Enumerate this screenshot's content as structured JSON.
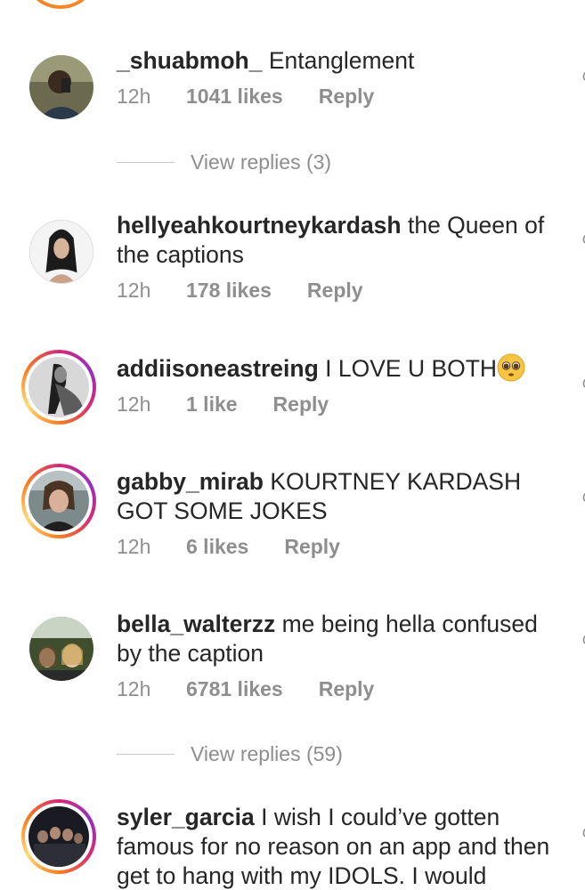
{
  "comments": [
    {
      "username": "_shuabmoh_",
      "text": "Entanglement",
      "time": "12h",
      "likes": "1041 likes",
      "reply_label": "Reply",
      "story_ring": false
    },
    {
      "username": "hellyeahkourtneykardash",
      "text": "the Queen of the captions",
      "time": "12h",
      "likes": "178 likes",
      "reply_label": "Reply",
      "story_ring": false
    },
    {
      "username": "addiisoneastreing",
      "text": "I LOVE U BOTH",
      "emoji": "pleading-face-emoji",
      "time": "12h",
      "likes": "1 like",
      "reply_label": "Reply",
      "story_ring": true
    },
    {
      "username": "gabby_mirab",
      "text": "KOURTNEY KARDASH GOT SOME JOKES",
      "time": "12h",
      "likes": "6 likes",
      "reply_label": "Reply",
      "story_ring": true
    },
    {
      "username": "bella_walterzz",
      "text": "me being hella confused by the caption",
      "time": "12h",
      "likes": "6781 likes",
      "reply_label": "Reply",
      "story_ring": false
    },
    {
      "username": "syler_garcia",
      "text": "I wish I could’ve gotten famous for no reason on an app and then get to hang with my IDOLS. I would",
      "story_ring": true
    }
  ],
  "view_replies": [
    {
      "label": "View replies (3)"
    },
    {
      "label": "View replies (59)"
    }
  ],
  "icons": {
    "like": "heart-outline-icon",
    "emoji": "pleading-face-emoji"
  },
  "colors": {
    "text": "#262626",
    "secondary": "#8e8e8e",
    "story_ring_start": "#d62976",
    "story_ring_end": "#feda75"
  }
}
